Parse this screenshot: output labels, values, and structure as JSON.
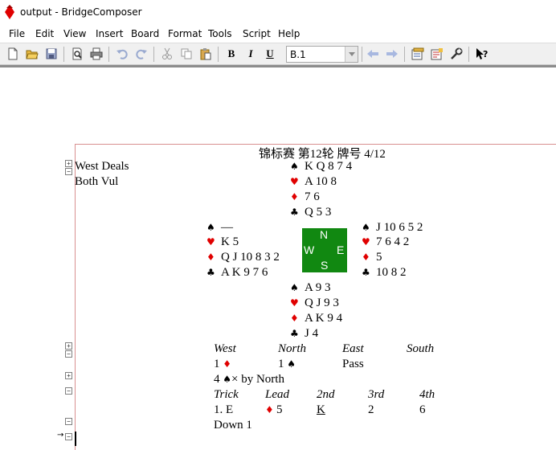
{
  "window": {
    "title": "output - BridgeComposer"
  },
  "menu": [
    "File",
    "Edit",
    "View",
    "Insert",
    "Board",
    "Format",
    "Tools",
    "Script",
    "Help"
  ],
  "toolbar": {
    "bold": "B",
    "italic": "I",
    "underline": "U",
    "style_value": "B.1",
    "icons": [
      "new-document-icon",
      "open-folder-icon",
      "save-icon",
      "print-preview-icon",
      "print-icon",
      "undo-icon",
      "redo-icon",
      "cut-icon",
      "copy-icon",
      "paste-icon",
      "bold-icon",
      "italic-icon",
      "underline-icon",
      "back-arrow-icon",
      "forward-arrow-icon",
      "options-icon",
      "page-setup-icon",
      "wrench-icon",
      "help-pointer-icon"
    ]
  },
  "board": {
    "header": "锦标赛 第12轮 牌号 4/12",
    "dealer": "West Deals",
    "vul": "Both Vul",
    "north": {
      "spades": "K Q 8 7 4",
      "hearts": "A 10 8",
      "diamonds": "7 6",
      "clubs": "Q 5 3"
    },
    "west": {
      "spades": "—",
      "hearts": "K 5",
      "diamonds": "Q J 10 8 3 2",
      "clubs": "A K 9 7 6"
    },
    "east": {
      "spades": "J 10 6 5 2",
      "hearts": "7 6 4 2",
      "diamonds": "5",
      "clubs": "10 8 2"
    },
    "south": {
      "spades": "A 9 3",
      "hearts": "Q J 9 3",
      "diamonds": "A K 9 4",
      "clubs": "J 4"
    },
    "compass": {
      "n": "N",
      "e": "E",
      "s": "S",
      "w": "W"
    },
    "auction": {
      "headers": [
        "West",
        "North",
        "East",
        "South"
      ],
      "west_bid": "1",
      "north_bid": "1",
      "east_bid": "Pass"
    },
    "contract": {
      "level": "4",
      "rest": "× by North"
    },
    "play": {
      "headers": [
        "Trick",
        "Lead",
        "2nd",
        "3rd",
        "4th"
      ],
      "row": {
        "trick": "1. E",
        "lead": "5",
        "second": "K",
        "third": "2",
        "fourth": "6"
      }
    },
    "result": "Down 1"
  },
  "colors": {
    "red_suit": "#e00000",
    "compass_green": "#118811",
    "page_border": "#d89090"
  }
}
